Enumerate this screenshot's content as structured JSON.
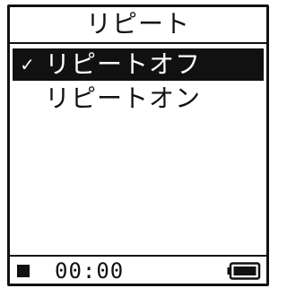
{
  "screen": {
    "title": "リピート"
  },
  "menu": {
    "items": [
      {
        "label": "リピートオフ",
        "checked": true,
        "selected": true,
        "check_mark": "✓"
      },
      {
        "label": "リピートオン",
        "checked": false,
        "selected": false,
        "check_mark": ""
      }
    ]
  },
  "status": {
    "playback_icon": "stop-icon",
    "time": "00:00",
    "battery_icon": "battery-icon",
    "battery_level": 1.0
  },
  "colors": {
    "foreground": "#111111",
    "background": "#ffffff",
    "highlight": "#111111",
    "highlight_text": "#ffffff"
  }
}
